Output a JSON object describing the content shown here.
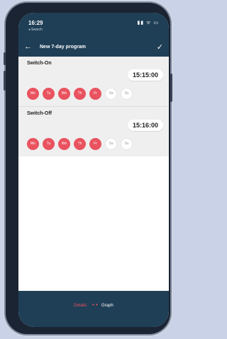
{
  "status": {
    "time": "16:29",
    "search_label": "◂ Search",
    "icons": "▮▮ ᯤ ▭"
  },
  "appbar": {
    "back_icon": "←",
    "title": "New 7-day program",
    "confirm_icon": "✓"
  },
  "switch_on": {
    "label": "Switch-On",
    "time": "15:15:00",
    "days": [
      {
        "label": "Mo",
        "active": true
      },
      {
        "label": "Tu",
        "active": true
      },
      {
        "label": "We",
        "active": true
      },
      {
        "label": "Th",
        "active": true
      },
      {
        "label": "Fr",
        "active": true
      },
      {
        "label": "Sa",
        "active": false
      },
      {
        "label": "Su",
        "active": false
      }
    ]
  },
  "switch_off": {
    "label": "Switch-Off",
    "time": "15:16:00",
    "days": [
      {
        "label": "Mo",
        "active": true
      },
      {
        "label": "Tu",
        "active": true
      },
      {
        "label": "We",
        "active": true
      },
      {
        "label": "Th",
        "active": true
      },
      {
        "label": "Fr",
        "active": true
      },
      {
        "label": "Sa",
        "active": false
      },
      {
        "label": "Su",
        "active": false
      }
    ]
  },
  "bottom_tabs": {
    "details": "Details",
    "graph": "Graph",
    "dots": "• •"
  },
  "colors": {
    "header": "#1f3f56",
    "accent": "#e9535f",
    "section_bg": "#efefef"
  }
}
